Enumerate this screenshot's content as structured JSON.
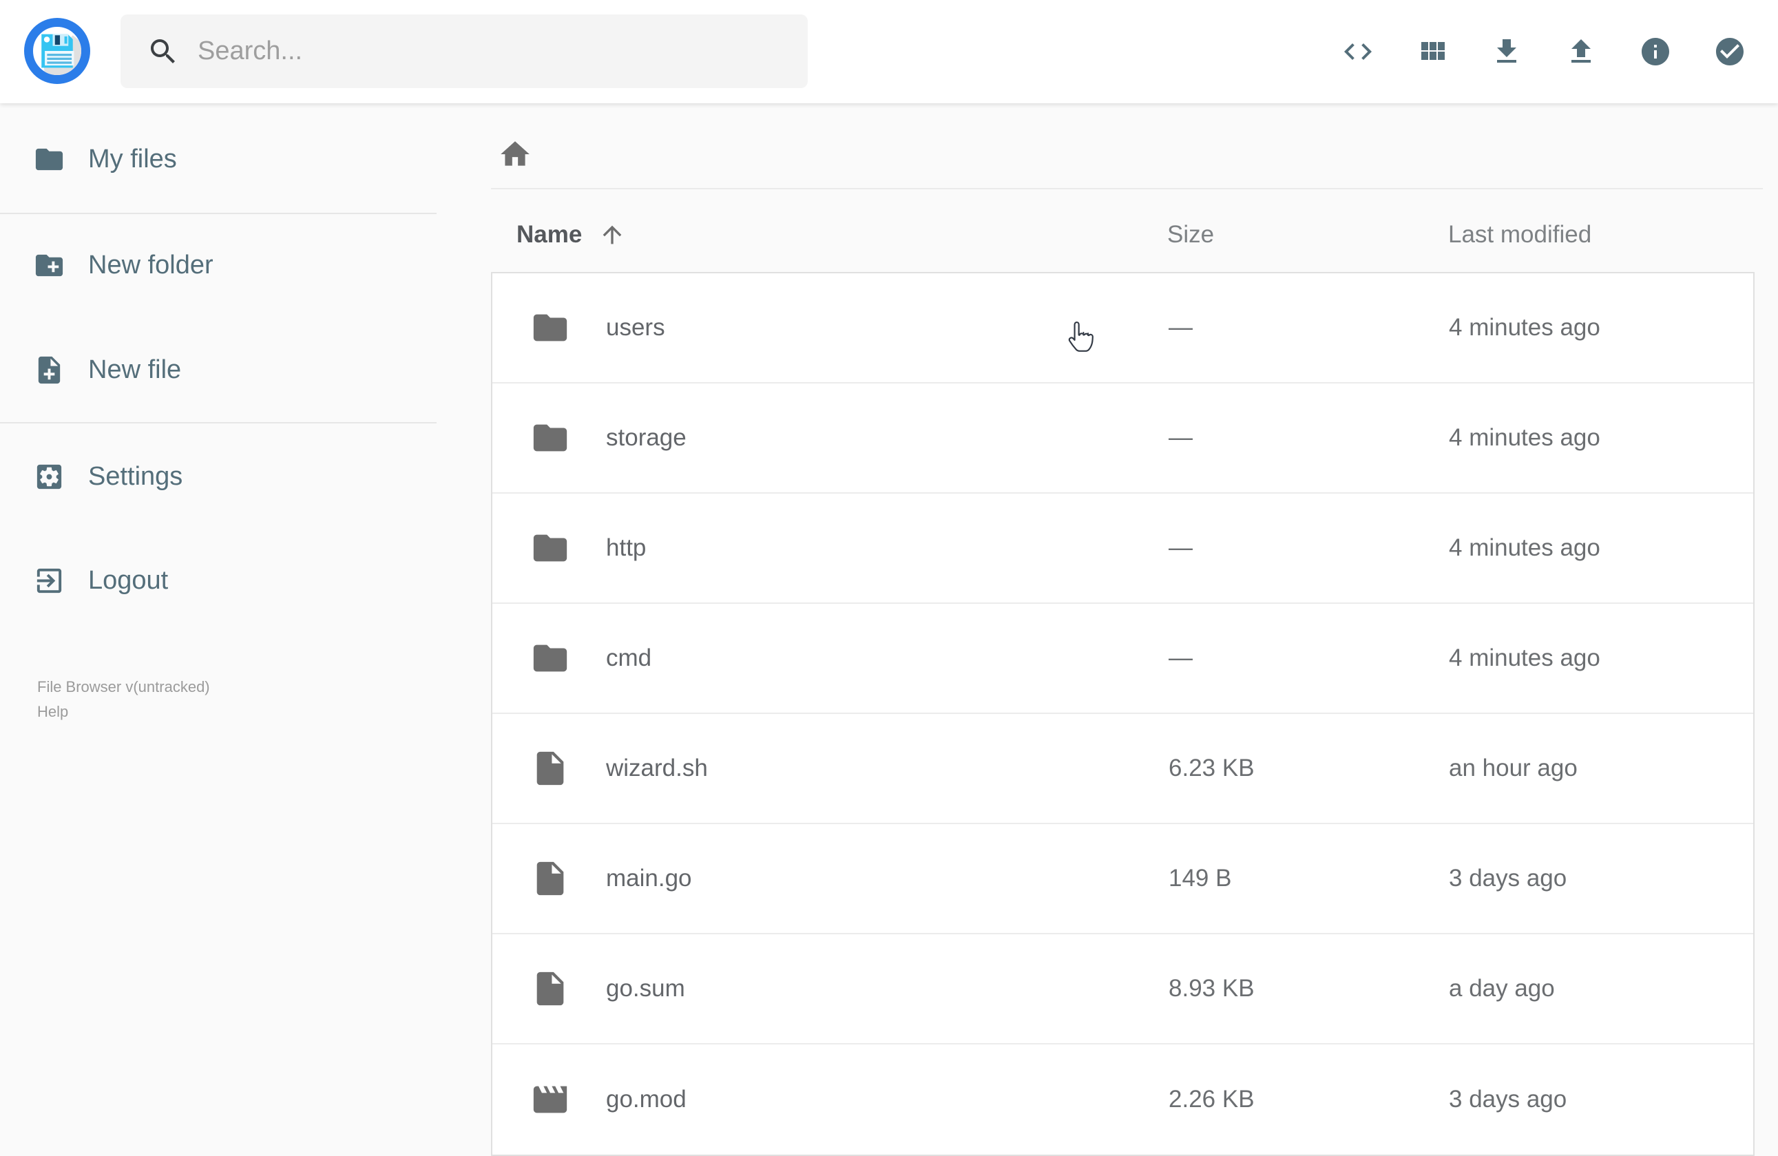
{
  "app": {
    "name": "File Browser"
  },
  "header": {
    "search": {
      "placeholder": "Search...",
      "value": ""
    },
    "actions": [
      {
        "id": "shell",
        "icon": "code-icon"
      },
      {
        "id": "view",
        "icon": "grid-view-icon"
      },
      {
        "id": "download",
        "icon": "download-icon"
      },
      {
        "id": "upload",
        "icon": "upload-icon"
      },
      {
        "id": "info",
        "icon": "info-icon"
      },
      {
        "id": "select",
        "icon": "check-circle-icon"
      }
    ]
  },
  "sidebar": {
    "items": [
      {
        "label": "My files",
        "icon": "folder-icon"
      },
      {
        "label": "New folder",
        "icon": "create-new-folder-icon"
      },
      {
        "label": "New file",
        "icon": "note-add-icon"
      },
      {
        "label": "Settings",
        "icon": "settings-icon"
      },
      {
        "label": "Logout",
        "icon": "logout-icon"
      }
    ],
    "footer": {
      "version": "File Browser v(untracked)",
      "help": "Help"
    }
  },
  "breadcrumb": {
    "root_icon": "home-icon"
  },
  "listing": {
    "columns": {
      "name": "Name",
      "size": "Size",
      "modified": "Last modified"
    },
    "sort": {
      "column": "name",
      "direction": "ascending"
    },
    "rows": [
      {
        "name": "users",
        "type": "folder",
        "size": "—",
        "modified": "4 minutes ago"
      },
      {
        "name": "storage",
        "type": "folder",
        "size": "—",
        "modified": "4 minutes ago"
      },
      {
        "name": "http",
        "type": "folder",
        "size": "—",
        "modified": "4 minutes ago"
      },
      {
        "name": "cmd",
        "type": "folder",
        "size": "—",
        "modified": "4 minutes ago"
      },
      {
        "name": "wizard.sh",
        "type": "file",
        "size": "6.23 KB",
        "modified": "an hour ago"
      },
      {
        "name": "main.go",
        "type": "file",
        "size": "149 B",
        "modified": "3 days ago"
      },
      {
        "name": "go.sum",
        "type": "file",
        "size": "8.93 KB",
        "modified": "a day ago"
      },
      {
        "name": "go.mod",
        "type": "movie",
        "size": "2.26 KB",
        "modified": "3 days ago"
      }
    ]
  },
  "colors": {
    "accent_slate": "#546e7a",
    "logo_ring_blue": "#2b7de9",
    "floppy_blue": "#35c4f2",
    "body_bg": "#fafafa",
    "header_bg": "#ffffff",
    "search_bg": "#f4f4f4",
    "row_text": "#63666a",
    "muted_text": "#9b9b9b",
    "border": "#e0e0e0"
  }
}
